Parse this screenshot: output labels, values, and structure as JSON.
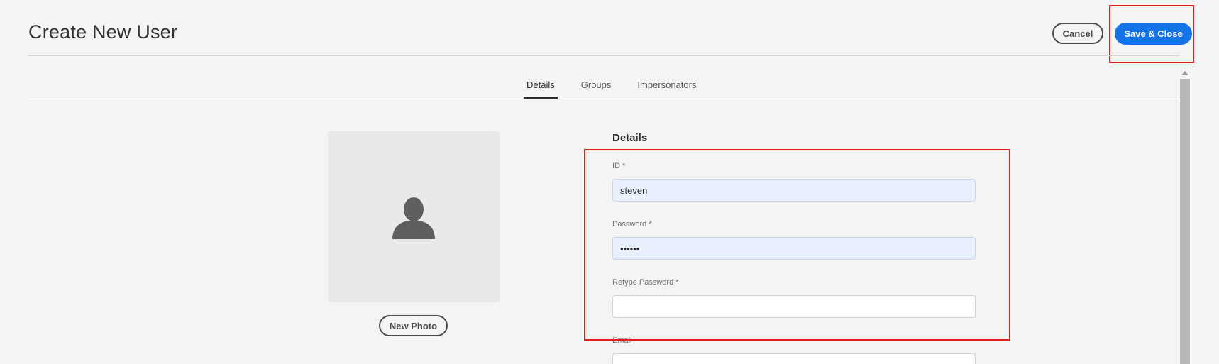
{
  "header": {
    "title": "Create New User",
    "cancel_label": "Cancel",
    "save_label": "Save & Close"
  },
  "tabs": [
    {
      "label": "Details",
      "active": true
    },
    {
      "label": "Groups",
      "active": false
    },
    {
      "label": "Impersonators",
      "active": false
    }
  ],
  "photo": {
    "icon": "user-silhouette-icon",
    "new_photo_label": "New Photo"
  },
  "details": {
    "section_title": "Details",
    "fields": [
      {
        "label": "ID *",
        "value": "steven"
      },
      {
        "label": "Password *",
        "value": "••••••"
      },
      {
        "label": "Retype Password *",
        "value": ""
      },
      {
        "label": "Email",
        "value": ""
      }
    ]
  },
  "colors": {
    "accent": "#1473e6",
    "highlight": "#e02020",
    "autofill": "#e8f0fe"
  }
}
